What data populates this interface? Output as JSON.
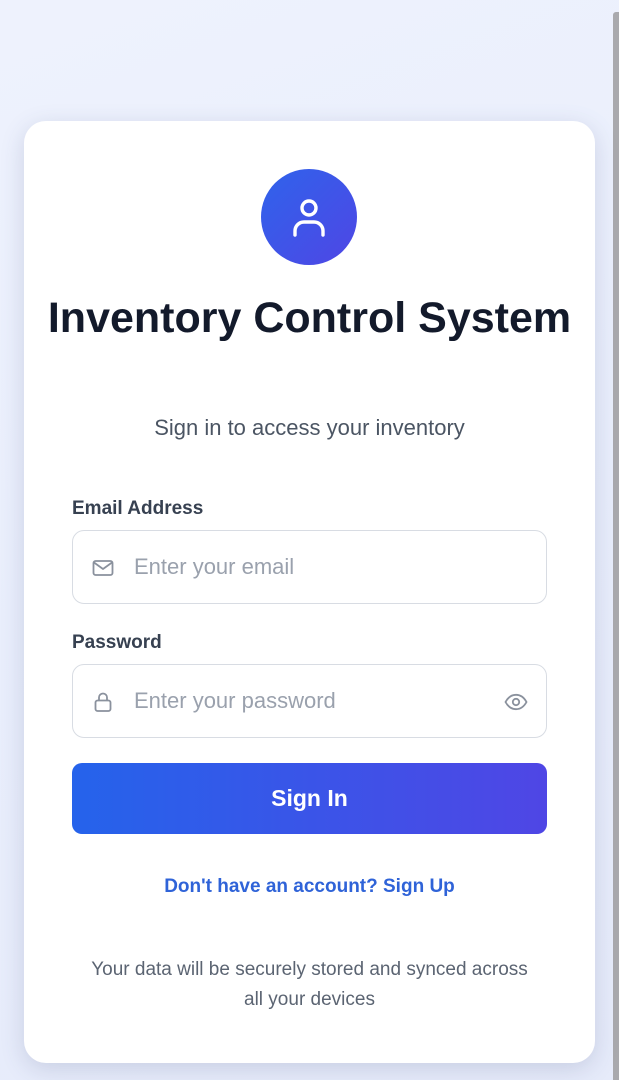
{
  "app": {
    "title": "Inventory Control System",
    "subtitle": "Sign in to access your inventory"
  },
  "icons": {
    "avatar": "user-icon",
    "email": "mail-icon",
    "password": "lock-icon",
    "visibility": "eye-icon"
  },
  "form": {
    "email": {
      "label": "Email Address",
      "placeholder": "Enter your email",
      "value": ""
    },
    "password": {
      "label": "Password",
      "placeholder": "Enter your password",
      "value": ""
    },
    "submit_label": "Sign In"
  },
  "signup_link": "Don't have an account? Sign Up",
  "footer_note": "Your data will be securely stored and synced across all your devices",
  "colors": {
    "accent_start": "#2563eb",
    "accent_end": "#4f46e5",
    "link": "#2f63d8",
    "title": "#131a2b"
  }
}
